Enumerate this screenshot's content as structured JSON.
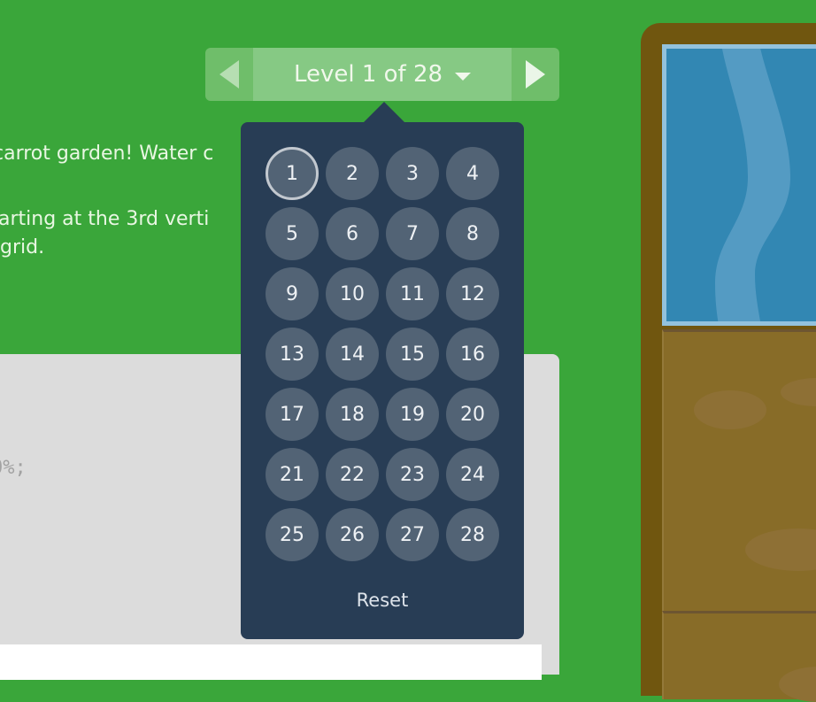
{
  "instructions": {
    "paragraph_1": "carrot garden! Water c",
    "paragraph_2_line_1": "arting at the 3rd verti",
    "paragraph_2_line_2": "grid."
  },
  "code_editor": {
    "visible_code_fragment": "0%;"
  },
  "level_nav": {
    "label": "Level 1 of 28",
    "current_level": 1,
    "total_levels": 28,
    "prev_icon": "triangle-left-icon",
    "next_icon": "triangle-right-icon",
    "dropdown_icon": "caret-down-icon"
  },
  "level_dropdown": {
    "levels": [
      "1",
      "2",
      "3",
      "4",
      "5",
      "6",
      "7",
      "8",
      "9",
      "10",
      "11",
      "12",
      "13",
      "14",
      "15",
      "16",
      "17",
      "18",
      "19",
      "20",
      "21",
      "22",
      "23",
      "24",
      "25",
      "26",
      "27",
      "28"
    ],
    "reset_label": "Reset"
  },
  "colors": {
    "background_green": "#3aa63a",
    "dropdown_bg": "#283d55",
    "level_circle": "#526375",
    "water": "#3287b3",
    "soil": "#886c28",
    "board_frame": "#70560f"
  }
}
